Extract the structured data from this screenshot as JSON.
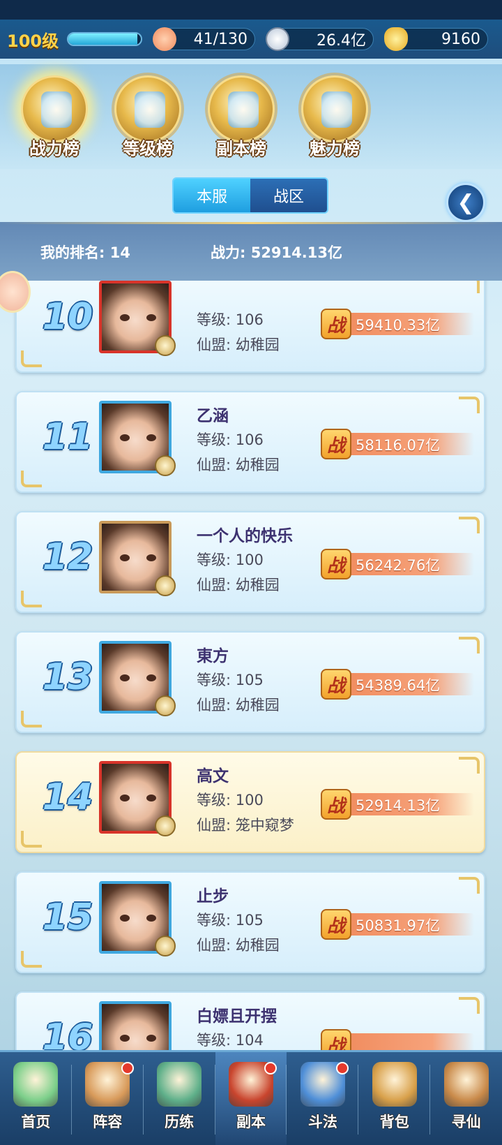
{
  "header": {
    "level_label": "100级",
    "xp_fraction": 0.95,
    "resources": [
      {
        "icon": "peach-icon",
        "value": "41/130"
      },
      {
        "icon": "coin-icon",
        "value": "26.4亿"
      },
      {
        "icon": "gold-ingot-icon",
        "value": "9160"
      }
    ]
  },
  "rank_tabs": [
    {
      "label": "战力榜",
      "active": true
    },
    {
      "label": "等级榜",
      "active": false
    },
    {
      "label": "副本榜",
      "active": false
    },
    {
      "label": "魅力榜",
      "active": false
    }
  ],
  "segment": {
    "server": "本服",
    "zone": "战区"
  },
  "my_rank": {
    "rank_text": "我的排名: 14",
    "power_text": "战力: 52914.13亿"
  },
  "list": [
    {
      "rank": "10",
      "name": "",
      "level": "等级: 106",
      "guild": "仙盟: 幼稚园",
      "power_icon": "战",
      "power": "59410.33亿",
      "frame": "red",
      "self": false
    },
    {
      "rank": "11",
      "name": "乙涵",
      "level": "等级: 106",
      "guild": "仙盟: 幼稚园",
      "power_icon": "战",
      "power": "58116.07亿",
      "frame": "blue",
      "self": false
    },
    {
      "rank": "12",
      "name": "一个人的快乐",
      "level": "等级: 100",
      "guild": "仙盟: 幼稚园",
      "power_icon": "战",
      "power": "56242.76亿",
      "frame": "bronze",
      "self": false
    },
    {
      "rank": "13",
      "name": "東方",
      "level": "等级: 105",
      "guild": "仙盟: 幼稚园",
      "power_icon": "战",
      "power": "54389.64亿",
      "frame": "blue",
      "self": false
    },
    {
      "rank": "14",
      "name": "高文",
      "level": "等级: 100",
      "guild": "仙盟: 笼中窥梦",
      "power_icon": "战",
      "power": "52914.13亿",
      "frame": "red",
      "self": true
    },
    {
      "rank": "15",
      "name": "止步",
      "level": "等级: 105",
      "guild": "仙盟: 幼稚园",
      "power_icon": "战",
      "power": "50831.97亿",
      "frame": "blue",
      "self": false
    },
    {
      "rank": "16",
      "name": "白嫖且开摆",
      "level": "等级: 104",
      "guild": "",
      "power_icon": "战",
      "power": "",
      "frame": "blue",
      "self": false
    }
  ],
  "bottom_nav": [
    {
      "label": "首页",
      "icon": "home-island-icon",
      "badge": false
    },
    {
      "label": "阵容",
      "icon": "lineup-scroll-icon",
      "badge": true
    },
    {
      "label": "历练",
      "icon": "training-beast-icon",
      "badge": false
    },
    {
      "label": "副本",
      "icon": "dungeon-gate-icon",
      "badge": true,
      "active": true
    },
    {
      "label": "斗法",
      "icon": "battle-sword-icon",
      "badge": true
    },
    {
      "label": "背包",
      "icon": "bag-icon",
      "badge": false
    },
    {
      "label": "寻仙",
      "icon": "seek-immortal-scroll-icon",
      "badge": false
    }
  ]
}
